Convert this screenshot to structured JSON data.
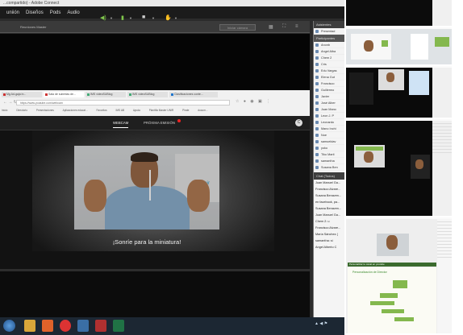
{
  "window": {
    "title": "...compartido) - Adobe Connect"
  },
  "menubar": {
    "items": [
      "uniión",
      "Diseños",
      "Pods",
      "Audio"
    ]
  },
  "video_pod": {
    "title": "Reuniones Master",
    "button_label": "Iniciar cámara"
  },
  "browser": {
    "tabs": [
      {
        "label": "Mg Ad-gaja in..."
      },
      {
        "label": "Sala de subrelas de..."
      },
      {
        "label": "IMS videoSUBlog"
      },
      {
        "label": "IMS videoSUBlog"
      },
      {
        "label": "Clasificaciones conte..."
      }
    ],
    "url": "https://www.youtube.com/webcam",
    "bookmarks": [
      "Inicio",
      "Directorio",
      "Presentaciones",
      "Aplicaciones educat...",
      "Favoritos",
      "IMS AB",
      "Ayuda",
      "Plantilla Master UNIR",
      "Pirate",
      "docum..."
    ]
  },
  "youtube": {
    "tab_webcam": "WEBCAM",
    "tab_next": "PRÓXIMA EMISIÓN",
    "avatar_letter": "C",
    "caption": "¡Sonríe para la miniatura!",
    "webcam_logo": "unir"
  },
  "right_panel": {
    "header": "Asistentes",
    "presenters_label": "Presentad",
    "participants_header": "Participantes",
    "participants": [
      "Anonb",
      "Angel Alba",
      "Chem 2",
      "Cris",
      "Edu Vargas",
      "Elena Gut",
      "Francisco",
      "Guillermo",
      "Javier",
      "José Alber",
      "Juan Mano",
      "Leon J. P",
      "Leonardo",
      "Mano Inchi",
      "Noe",
      "samueldav",
      "yoko",
      "Tiko Marti",
      "samantha",
      "Susana Ben"
    ],
    "chat_header": "Chat (Todos)",
    "chat_lines": [
      "Juan Manuel Ga...",
      "Francisco Alvare...",
      "Susana Benaven...",
      "en facebook, pa...",
      "Susana Benaven...",
      "Juan Manuel Ga...",
      "Chem 2: u",
      "Francisco Alvare...",
      "María Sánchez (",
      "samantha: sí",
      "Angel Alberto C"
    ]
  },
  "taskbar": {
    "tray_text": "▲ ◀ ⚑"
  },
  "thumbnails": {
    "slide_title": "Personalización de Director",
    "slide_subtitle": "Personalizar tu canal en youtube"
  },
  "colors": {
    "accent_green": "#7fc64b",
    "youtube_red": "#e22222",
    "taskbar": "#1c2733"
  }
}
